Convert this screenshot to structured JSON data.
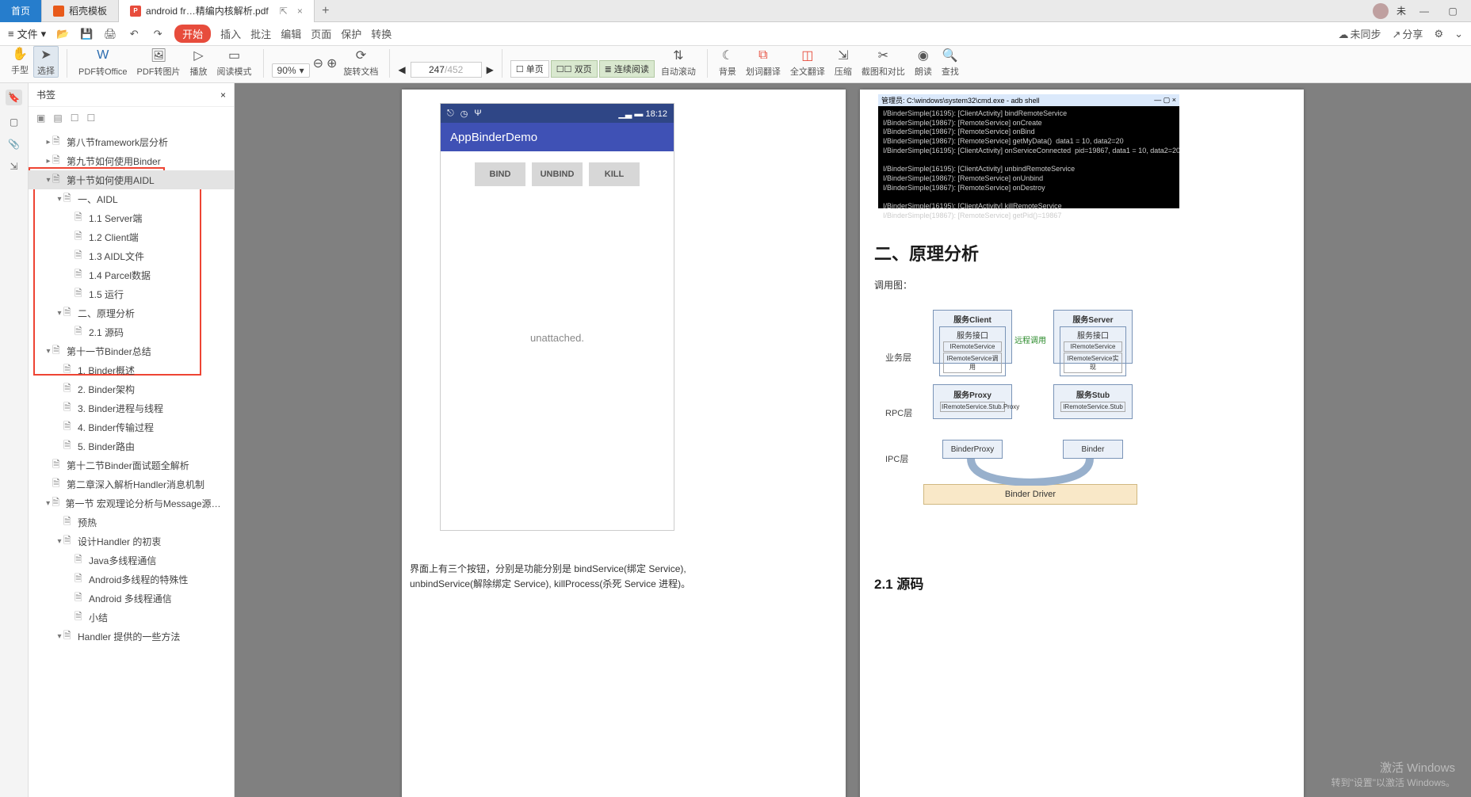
{
  "tabs": {
    "home": "首页",
    "template": "稻壳模板",
    "doc": "android fr…精编内核解析.pdf"
  },
  "titlebar": {
    "user": "未"
  },
  "menubar": {
    "file": "文件",
    "start": "开始",
    "insert": "插入",
    "review": "批注",
    "edit": "编辑",
    "page": "页面",
    "protect": "保护",
    "convert": "转换",
    "nosync": "未同步",
    "share": "分享"
  },
  "toolbar": {
    "hand": "手型",
    "select": "选择",
    "pdf2office": "PDF转Office",
    "pdf2img": "PDF转图片",
    "play": "播放",
    "readmode": "阅读模式",
    "zoom": "90%",
    "rotate": "旋转文档",
    "single": "单页",
    "double": "双页",
    "continuous": "连续阅读",
    "autoscroll": "自动滚动",
    "bg": "背景",
    "dictx": "划词翻译",
    "fulltx": "全文翻译",
    "compress": "压缩",
    "crop": "截图和对比",
    "read": "朗读",
    "find": "查找",
    "page_cur": "247",
    "page_total": "452"
  },
  "bookmarks": {
    "title": "书签",
    "items": [
      {
        "lvl": 1,
        "twist": "▸",
        "label": "第八节framework层分析"
      },
      {
        "lvl": 1,
        "twist": "▸",
        "label": "第九节如何使用Binder"
      },
      {
        "lvl": 1,
        "twist": "▾",
        "label": "第十节如何使用AIDL",
        "sel": true
      },
      {
        "lvl": 2,
        "twist": "▾",
        "label": "一、AIDL"
      },
      {
        "lvl": 3,
        "twist": "",
        "label": "1.1 Server端"
      },
      {
        "lvl": 3,
        "twist": "",
        "label": "1.2 Client端"
      },
      {
        "lvl": 3,
        "twist": "",
        "label": "1.3 AIDL文件"
      },
      {
        "lvl": 3,
        "twist": "",
        "label": "1.4 Parcel数据"
      },
      {
        "lvl": 3,
        "twist": "",
        "label": "1.5 运行"
      },
      {
        "lvl": 2,
        "twist": "▾",
        "label": "二、原理分析"
      },
      {
        "lvl": 3,
        "twist": "",
        "label": "2.1 源码"
      },
      {
        "lvl": 1,
        "twist": "▾",
        "label": "第十一节Binder总结"
      },
      {
        "lvl": 2,
        "twist": "",
        "label": "1. Binder概述"
      },
      {
        "lvl": 2,
        "twist": "",
        "label": "2. Binder架构"
      },
      {
        "lvl": 2,
        "twist": "",
        "label": "3. Binder进程与线程"
      },
      {
        "lvl": 2,
        "twist": "",
        "label": "4. Binder传输过程"
      },
      {
        "lvl": 2,
        "twist": "",
        "label": "5. Binder路由"
      },
      {
        "lvl": 1,
        "twist": "",
        "label": "第十二节Binder面试题全解析"
      },
      {
        "lvl": 1,
        "twist": "",
        "label": "第二章深入解析Handler消息机制"
      },
      {
        "lvl": 1,
        "twist": "▾",
        "label": "第一节 宏观理论分析与Message源码分析"
      },
      {
        "lvl": 2,
        "twist": "",
        "label": "预热"
      },
      {
        "lvl": 2,
        "twist": "▾",
        "label": "设计Handler 的初衷"
      },
      {
        "lvl": 3,
        "twist": "",
        "label": "Java多线程通信"
      },
      {
        "lvl": 3,
        "twist": "",
        "label": "Android多线程的特殊性"
      },
      {
        "lvl": 3,
        "twist": "",
        "label": "Android 多线程通信"
      },
      {
        "lvl": 3,
        "twist": "",
        "label": "小结"
      },
      {
        "lvl": 2,
        "twist": "▾",
        "label": "Handler 提供的一些方法"
      }
    ]
  },
  "leftpage": {
    "app_title": "AppBinderDemo",
    "time": "18:12",
    "btn_bind": "BIND",
    "btn_unbind": "UNBIND",
    "btn_kill": "KILL",
    "body": "unattached.",
    "para": "界面上有三个按钮，分别是功能分别是 bindService(绑定 Service), unbindService(解除绑定 Service), killProcess(杀死 Service 进程)。"
  },
  "rightpage": {
    "console_title": "管理员: C:\\windows\\system32\\cmd.exe - adb shell",
    "console_lines": [
      "I/BinderSimple(16195): [ClientActivity] bindRemoteService",
      "I/BinderSimple(19867): [RemoteService] onCreate",
      "I/BinderSimple(19867): [RemoteService] onBind",
      "I/BinderSimple(19867): [RemoteService] getMyData()  data1 = 10, data2=20",
      "I/BinderSimple(16195): [ClientActivity] onServiceConnected  pid=19867, data1 = 10, data2=20",
      "",
      "I/BinderSimple(16195): [ClientActivity] unbindRemoteService",
      "I/BinderSimple(19867): [RemoteService] onUnbind",
      "I/BinderSimple(19867): [RemoteService] onDestroy",
      "",
      "I/BinderSimple(16195): [ClientActivity] killRemoteService",
      "I/BinderSimple(19867): [RemoteService] getPid()=19867"
    ],
    "h2": "二、原理分析",
    "calldiag": "调用图：",
    "client": "服务Client",
    "server": "服务Server",
    "svcIf": "服务接口",
    "ir": "IRemoteService",
    "ircall": "IRemoteService调用",
    "irimpl": "IRemoteService实现",
    "proxy": "服务Proxy",
    "stub": "服务Stub",
    "stubproxy": "IRemoteService.Stub.Proxy",
    "stubcls": "IRemoteService.Stub",
    "bproxy": "BinderProxy",
    "binder": "Binder",
    "driver": "Binder Driver",
    "biz": "业务层",
    "rpc": "RPC层",
    "ipc": "IPC层",
    "remote": "远程调用",
    "h3": "2.1  源码"
  },
  "watermark": {
    "l1": "激活 Windows",
    "l2": "转到\"设置\"以激活 Windows。"
  }
}
